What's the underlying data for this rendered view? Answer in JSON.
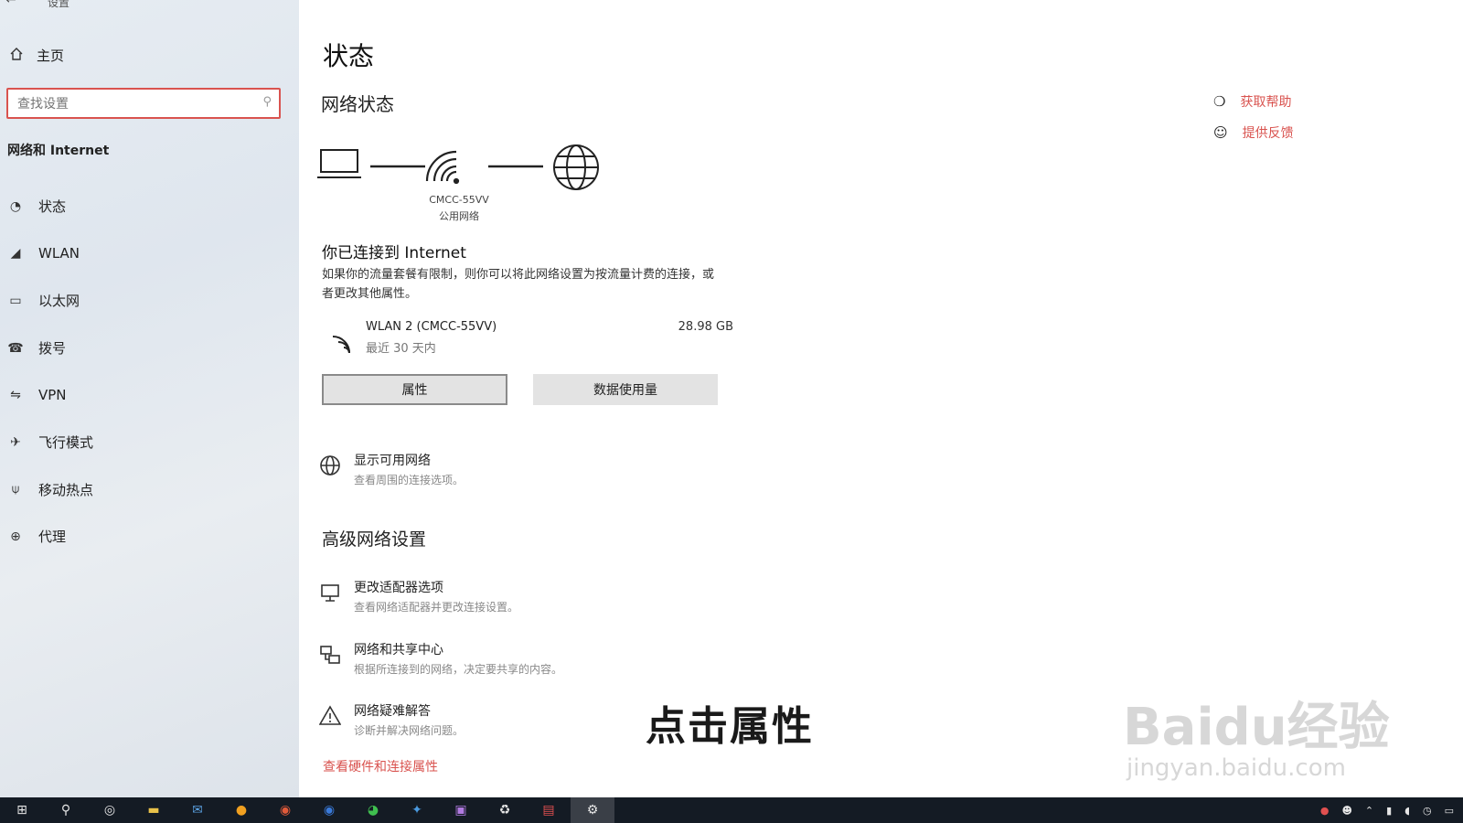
{
  "window": {
    "title": "设置"
  },
  "sidebar": {
    "home_label": "主页",
    "search_placeholder": "查找设置",
    "group_label": "网络和 Internet",
    "items": [
      {
        "label": "状态",
        "icon": "status-icon"
      },
      {
        "label": "WLAN",
        "icon": "wifi-icon"
      },
      {
        "label": "以太网",
        "icon": "ethernet-icon"
      },
      {
        "label": "拨号",
        "icon": "dialup-icon"
      },
      {
        "label": "VPN",
        "icon": "vpn-icon"
      },
      {
        "label": "飞行模式",
        "icon": "airplane-icon"
      },
      {
        "label": "移动热点",
        "icon": "hotspot-icon"
      },
      {
        "label": "代理",
        "icon": "proxy-icon"
      }
    ]
  },
  "main": {
    "title": "状态",
    "network_status_heading": "网络状态",
    "diagram": {
      "network_name": "CMCC-55VV",
      "network_type": "公用网络"
    },
    "connected_title": "你已连接到 Internet",
    "connected_desc": "如果你的流量套餐有限制，则你可以将此网络设置为按流量计费的连接，或者更改其他属性。",
    "adapter": {
      "name": "WLAN 2 (CMCC-55VV)",
      "subtitle": "最近 30 天内",
      "usage": "28.98 GB"
    },
    "buttons": {
      "properties": "属性",
      "data_usage": "数据使用量"
    },
    "show_networks": {
      "title": "显示可用网络",
      "desc": "查看周围的连接选项。"
    },
    "advanced_heading": "高级网络设置",
    "advanced_items": [
      {
        "title": "更改适配器选项",
        "desc": "查看网络适配器并更改连接设置。"
      },
      {
        "title": "网络和共享中心",
        "desc": "根据所连接到的网络，决定要共享的内容。"
      },
      {
        "title": "网络疑难解答",
        "desc": "诊断并解决网络问题。"
      }
    ],
    "hardware_link": "查看硬件和连接属性"
  },
  "help": {
    "get_help": "获取帮助",
    "feedback": "提供反馈"
  },
  "overlay": {
    "subtitle": "点击属性",
    "watermark_main": "Baidu经验",
    "watermark_sub": "jingyan.baidu.com"
  },
  "colors": {
    "accent_red": "#d9534f",
    "taskbar": "#141b24"
  }
}
